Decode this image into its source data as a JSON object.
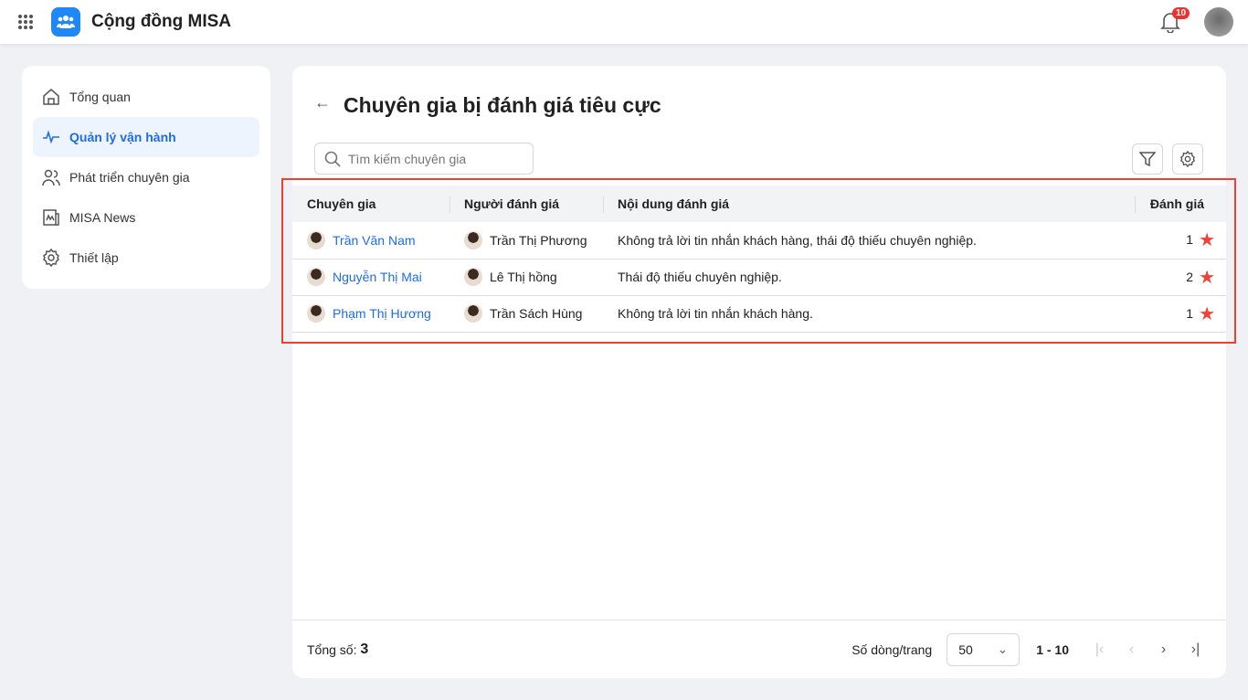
{
  "app": {
    "title": "Cộng đồng MISA",
    "notification_count": "10"
  },
  "sidebar": {
    "items": [
      {
        "label": "Tổng quan",
        "icon": "home-icon"
      },
      {
        "label": "Quản lý vận hành",
        "icon": "activity-icon",
        "active": true
      },
      {
        "label": "Phát triển chuyên gia",
        "icon": "users-icon"
      },
      {
        "label": "MISA News",
        "icon": "news-icon"
      },
      {
        "label": "Thiết lập",
        "icon": "gear-icon"
      }
    ]
  },
  "page": {
    "title": "Chuyên gia bị đánh giá tiêu cực",
    "search_placeholder": "Tìm kiếm chuyên gia"
  },
  "table": {
    "columns": [
      "Chuyên gia",
      "Người đánh giá",
      "Nội dung đánh giá",
      "Đánh giá"
    ],
    "rows": [
      {
        "expert": "Trần Văn Nam",
        "reviewer": "Trần Thị Phương",
        "content": "Không trả lời tin nhắn khách hàng, thái độ thiếu chuyên nghiệp.",
        "rating": "1"
      },
      {
        "expert": "Nguyễn Thị Mai",
        "reviewer": "Lê Thị hồng",
        "content": "Thái độ thiếu chuyên nghiệp.",
        "rating": "2"
      },
      {
        "expert": "Phạm Thị Hương",
        "reviewer": "Trần Sách Hùng",
        "content": "Không trả lời tin nhắn khách hàng.",
        "rating": "1"
      }
    ]
  },
  "footer": {
    "total_label": "Tổng số:",
    "total": "3",
    "rows_per_page_label": "Số dòng/trang",
    "rows_per_page": "50",
    "range": "1 - 10"
  },
  "colors": {
    "accent": "#1e6ce8",
    "star": "#f0413a",
    "annotation": "#ea4335"
  }
}
